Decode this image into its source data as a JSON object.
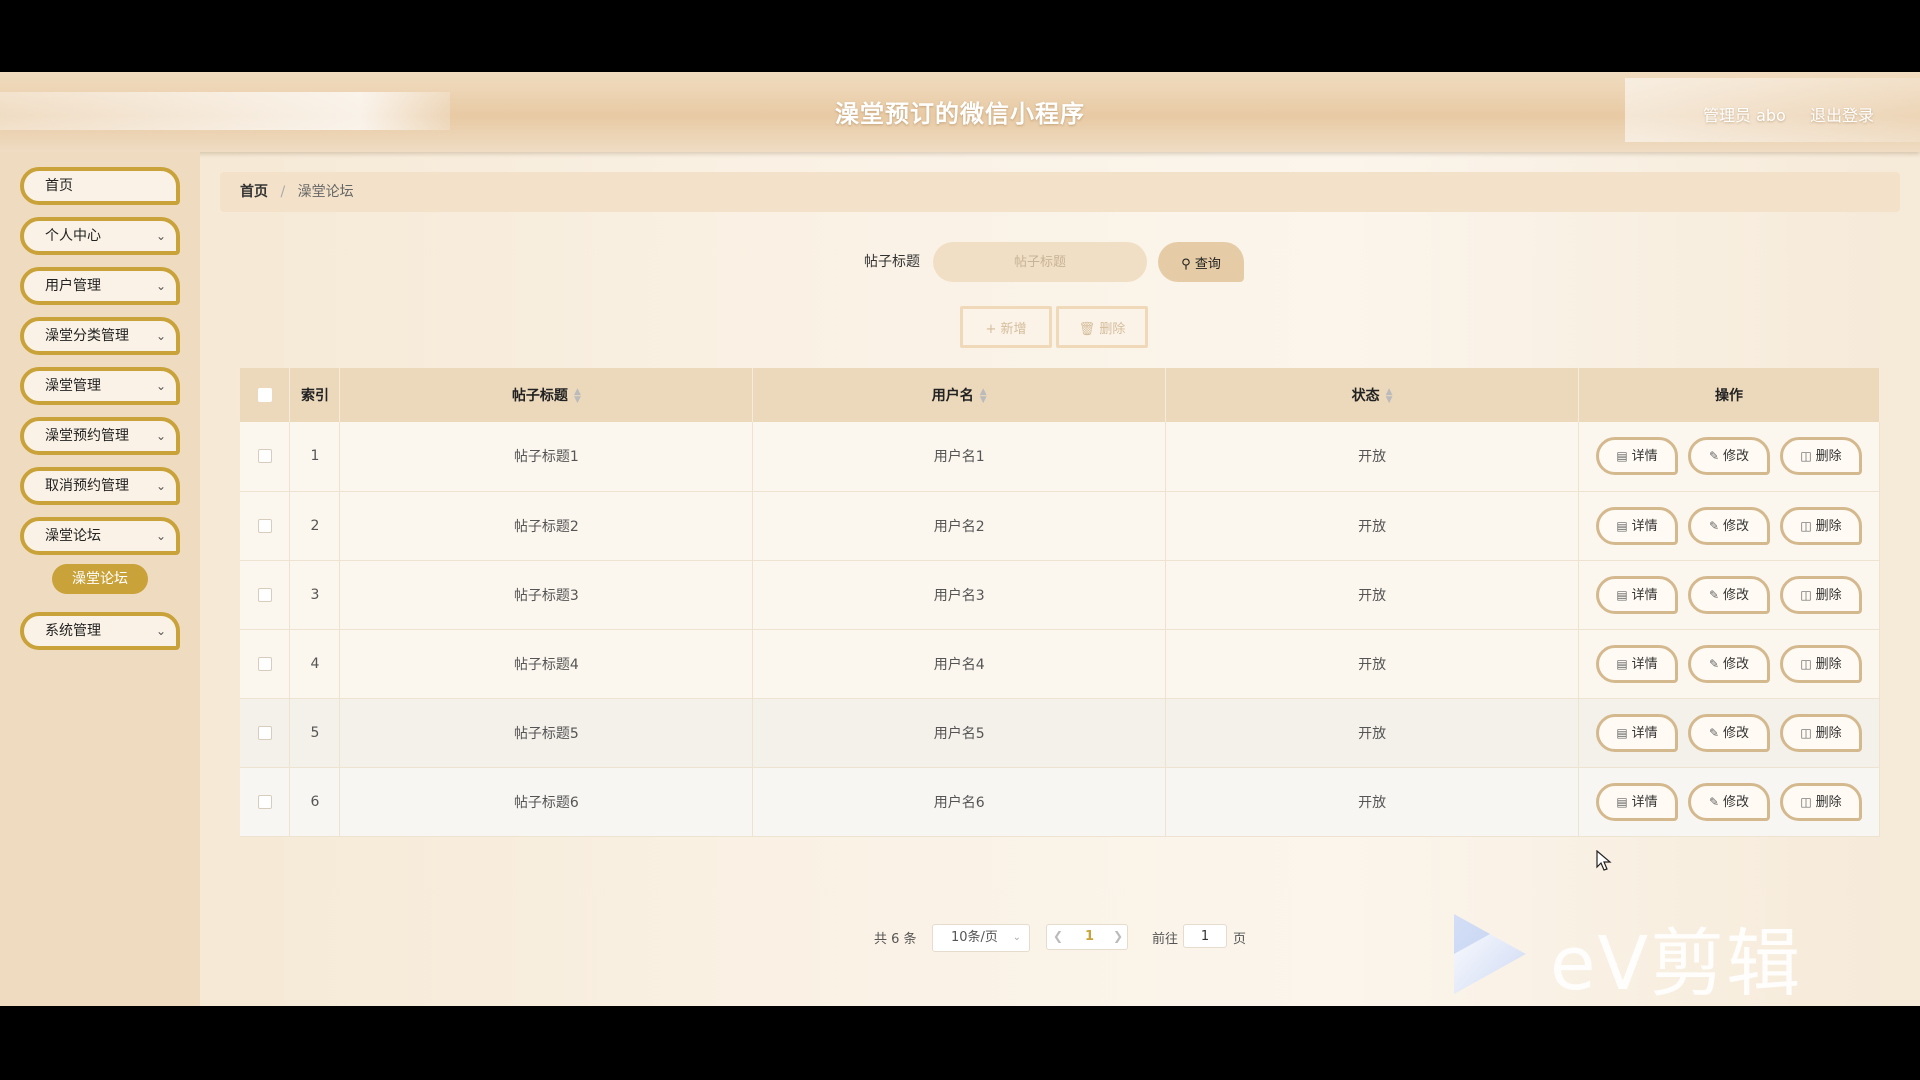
{
  "header": {
    "title": "澡堂预订的微信小程序",
    "user": "管理员 abo",
    "logout": "退出登录"
  },
  "sidebar": {
    "items": [
      {
        "label": "首页",
        "chevron": false
      },
      {
        "label": "个人中心",
        "chevron": true
      },
      {
        "label": "用户管理",
        "chevron": true
      },
      {
        "label": "澡堂分类管理",
        "chevron": true
      },
      {
        "label": "澡堂管理",
        "chevron": true
      },
      {
        "label": "澡堂预约管理",
        "chevron": true
      },
      {
        "label": "取消预约管理",
        "chevron": true
      },
      {
        "label": "澡堂论坛",
        "chevron": true
      },
      {
        "label": "系统管理",
        "chevron": true
      }
    ],
    "sub_item": "澡堂论坛"
  },
  "breadcrumb": {
    "home": "首页",
    "current": "澡堂论坛"
  },
  "search": {
    "label": "帖子标题",
    "placeholder": "帖子标题",
    "button": "查询"
  },
  "actions": {
    "add": "新增",
    "delete": "删除"
  },
  "table": {
    "headers": [
      "索引",
      "帖子标题",
      "用户名",
      "状态",
      "操作"
    ],
    "rows": [
      {
        "index": "1",
        "title": "帖子标题1",
        "user": "用户名1",
        "status": "开放"
      },
      {
        "index": "2",
        "title": "帖子标题2",
        "user": "用户名2",
        "status": "开放"
      },
      {
        "index": "3",
        "title": "帖子标题3",
        "user": "用户名3",
        "status": "开放"
      },
      {
        "index": "4",
        "title": "帖子标题4",
        "user": "用户名4",
        "status": "开放"
      },
      {
        "index": "5",
        "title": "帖子标题5",
        "user": "用户名5",
        "status": "开放"
      },
      {
        "index": "6",
        "title": "帖子标题6",
        "user": "用户名6",
        "status": "开放"
      }
    ],
    "row_actions": {
      "detail": "详情",
      "edit": "修改",
      "delete": "删除"
    }
  },
  "pagination": {
    "total": "共 6 条",
    "page_size": "10条/页",
    "current_page": "1",
    "goto_label": "前往",
    "goto_value": "1",
    "page_suffix": "页"
  },
  "watermark": "eV剪辑",
  "colors": {
    "accent_gold": "#c9a23a",
    "header_bg": "#e8caa4",
    "table_header_bg": "#ecd9bc"
  }
}
